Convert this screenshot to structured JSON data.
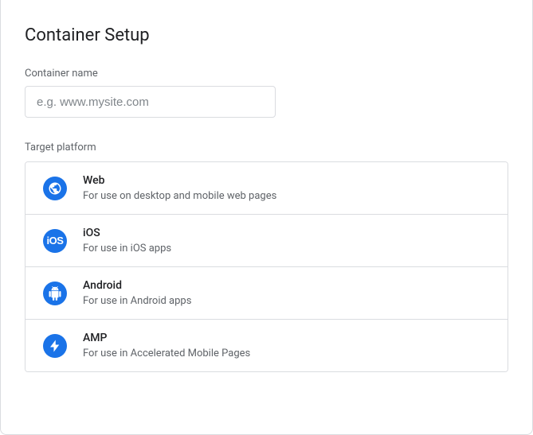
{
  "title": "Container Setup",
  "container_name": {
    "label": "Container name",
    "value": "",
    "placeholder": "e.g. www.mysite.com"
  },
  "target_platform": {
    "label": "Target platform",
    "options": [
      {
        "id": "web",
        "name": "Web",
        "desc": "For use on desktop and mobile web pages",
        "icon": "globe-icon"
      },
      {
        "id": "ios",
        "name": "iOS",
        "desc": "For use in iOS apps",
        "icon": "ios-icon"
      },
      {
        "id": "android",
        "name": "Android",
        "desc": "For use in Android apps",
        "icon": "android-icon"
      },
      {
        "id": "amp",
        "name": "AMP",
        "desc": "For use in Accelerated Mobile Pages",
        "icon": "amp-icon"
      }
    ]
  }
}
